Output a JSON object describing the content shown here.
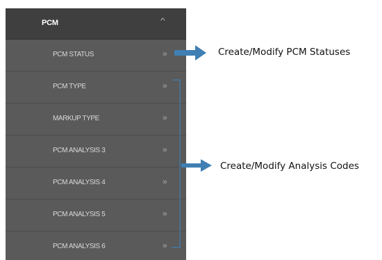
{
  "menu": {
    "header": {
      "label": "PCM",
      "caret_glyph": "^"
    },
    "chevron_glyph": "»",
    "items": [
      {
        "label": "PCM STATUS",
        "name": "menu-item-pcm-status"
      },
      {
        "label": "PCM TYPE",
        "name": "menu-item-pcm-type"
      },
      {
        "label": "MARKUP TYPE",
        "name": "menu-item-markup-type"
      },
      {
        "label": "PCM ANALYSIS 3",
        "name": "menu-item-pcm-analysis-3"
      },
      {
        "label": "PCM ANALYSIS 4",
        "name": "menu-item-pcm-analysis-4"
      },
      {
        "label": "PCM ANALYSIS 5",
        "name": "menu-item-pcm-analysis-5"
      },
      {
        "label": "PCM ANALYSIS 6",
        "name": "menu-item-pcm-analysis-6"
      }
    ]
  },
  "annotations": {
    "status_callout": "Create/Modify PCM Statuses",
    "analysis_callout": "Create/Modify Analysis Codes",
    "arrow_color": "#3f7fb3"
  }
}
